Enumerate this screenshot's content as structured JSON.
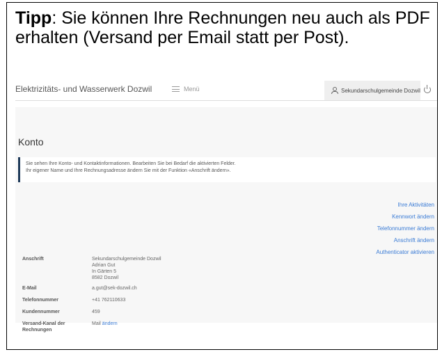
{
  "tip": {
    "label": "Tipp",
    "text": ": Sie können Ihre Rechnungen neu auch als PDF erhalten (Versand per Email statt per Post)."
  },
  "header": {
    "app_title": "Elektrizitäts- und Wasserwerk Dozwil",
    "menu_label": "Menü",
    "user_name": "Sekundarschulgemeinde Dozwil"
  },
  "page": {
    "title": "Konto",
    "info_line1": "Sie sehen Ihre Konto- und Kontaktinformationen. Bearbeiten Sie bei Bedarf die aktivierten Felder.",
    "info_line2": "Ihr eigener Name und Ihre Rechnungsadresse ändern Sie mit der Funktion «Anschrift ändern»."
  },
  "actions": [
    "Ihre Aktivitäten",
    "Kennwort ändern",
    "Telefonnummer ändern",
    "Anschrift ändern",
    "Authenticator aktivieren"
  ],
  "account": {
    "address_label": "Anschrift",
    "address_lines": [
      "Sekundarschulgemeinde Dozwil",
      "Adrian Gut",
      "In Gärten 5",
      "8582 Dozwil"
    ],
    "email_label": "E-Mail",
    "email_value": "a.gut@sek-dozwil.ch",
    "phone_label": "Telefonnummer",
    "phone_value": "+41 762110633",
    "customer_label": "Kundennummer",
    "customer_value": "459",
    "channel_label": "Versand-Kanal der Rechnungen",
    "channel_value": "Mail",
    "channel_change": "ändern"
  }
}
